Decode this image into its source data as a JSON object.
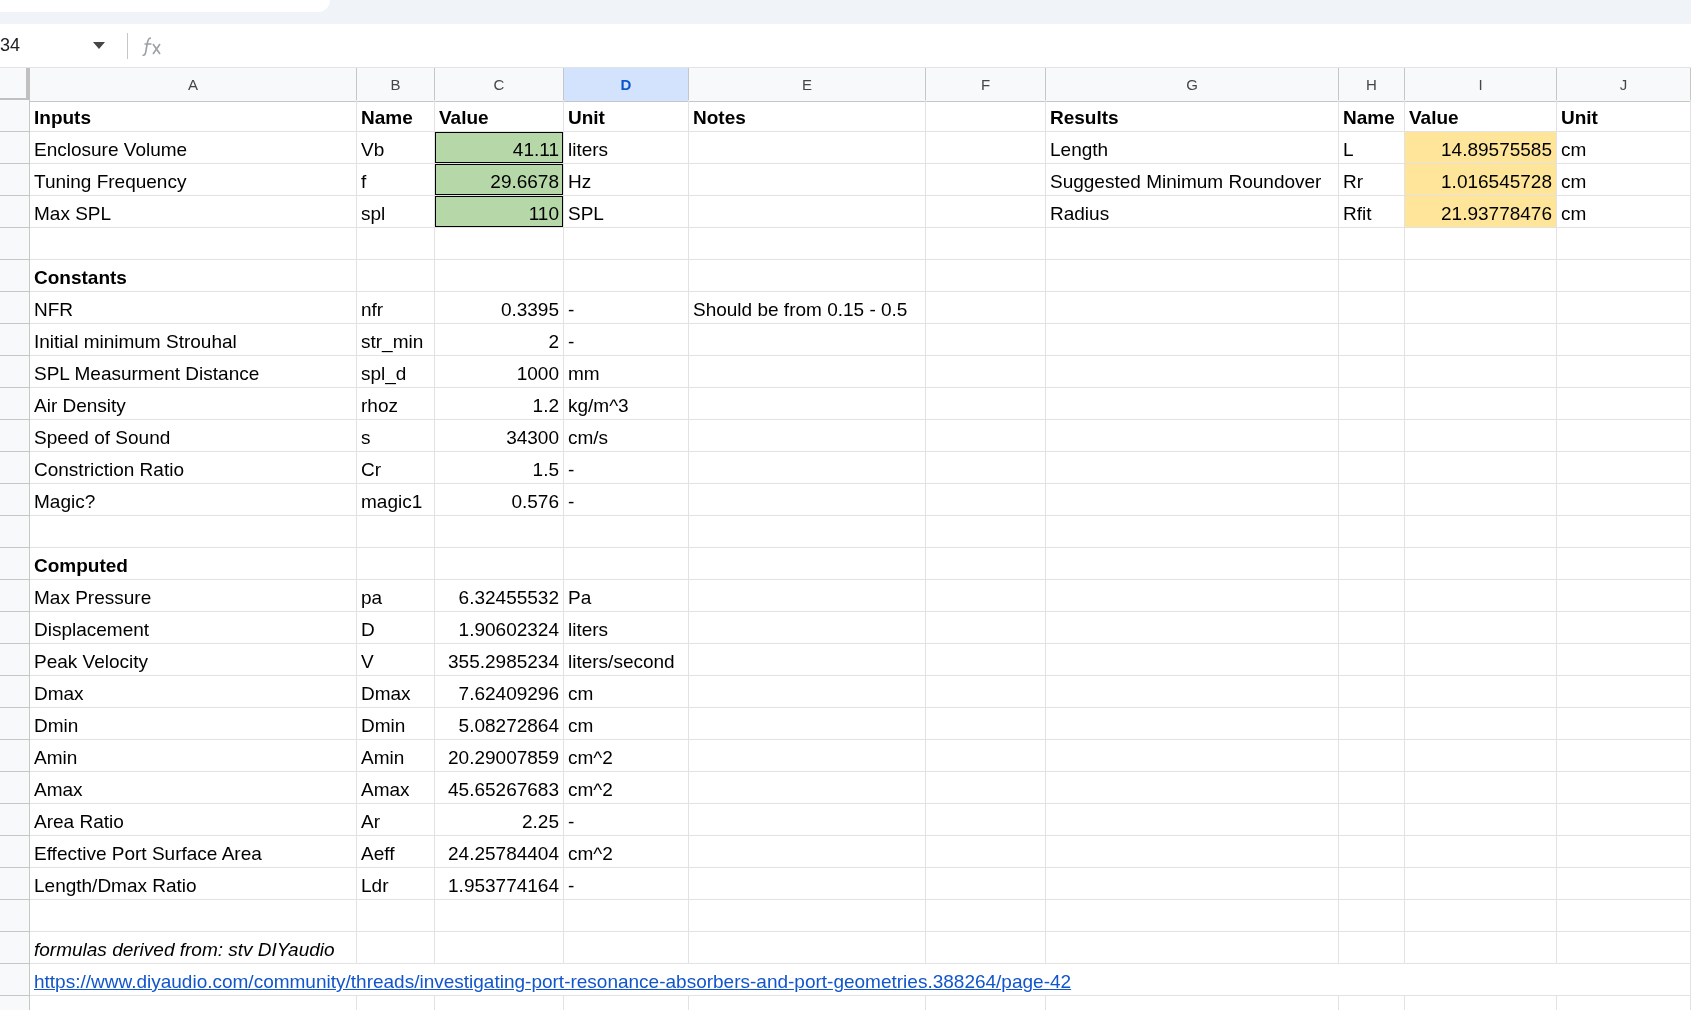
{
  "name_box": "34",
  "columns": [
    {
      "label": "A",
      "selected": false
    },
    {
      "label": "B",
      "selected": false
    },
    {
      "label": "C",
      "selected": false
    },
    {
      "label": "D",
      "selected": true
    },
    {
      "label": "E",
      "selected": false
    },
    {
      "label": "F",
      "selected": false
    },
    {
      "label": "G",
      "selected": false
    },
    {
      "label": "H",
      "selected": false
    },
    {
      "label": "I",
      "selected": false
    },
    {
      "label": "J",
      "selected": false
    }
  ],
  "rows": [
    {
      "A": {
        "kind": "header",
        "text": "Inputs"
      },
      "B": {
        "kind": "header",
        "text": "Name"
      },
      "C": {
        "kind": "header",
        "text": "Value"
      },
      "D": {
        "kind": "header",
        "text": "Unit"
      },
      "E": {
        "kind": "header",
        "text": "Notes"
      },
      "G": {
        "kind": "header",
        "text": "Results"
      },
      "H": {
        "kind": "header",
        "text": "Name"
      },
      "I": {
        "kind": "header",
        "text": "Value"
      },
      "J": {
        "kind": "header",
        "text": "Unit"
      }
    },
    {
      "A": {
        "kind": "text",
        "text": "Enclosure Volume"
      },
      "B": {
        "kind": "text",
        "text": "Vb"
      },
      "C": {
        "kind": "input",
        "text": "41.11"
      },
      "D": {
        "kind": "text",
        "text": "liters"
      },
      "G": {
        "kind": "text",
        "text": "Length"
      },
      "H": {
        "kind": "text",
        "text": "L"
      },
      "I": {
        "kind": "result",
        "text": "14.89575585"
      },
      "J": {
        "kind": "text",
        "text": "cm"
      }
    },
    {
      "A": {
        "kind": "text",
        "text": "Tuning Frequency"
      },
      "B": {
        "kind": "text",
        "text": "f"
      },
      "C": {
        "kind": "input",
        "text": "29.6678"
      },
      "D": {
        "kind": "text",
        "text": "Hz"
      },
      "G": {
        "kind": "text",
        "text": "Suggested Minimum Roundover"
      },
      "H": {
        "kind": "text",
        "text": "Rr"
      },
      "I": {
        "kind": "result",
        "text": "1.016545728"
      },
      "J": {
        "kind": "text",
        "text": "cm"
      }
    },
    {
      "A": {
        "kind": "text",
        "text": "Max SPL"
      },
      "B": {
        "kind": "text",
        "text": "spl"
      },
      "C": {
        "kind": "input",
        "text": "110"
      },
      "D": {
        "kind": "text",
        "text": "SPL"
      },
      "G": {
        "kind": "text",
        "text": "Radius"
      },
      "H": {
        "kind": "text",
        "text": "Rfit"
      },
      "I": {
        "kind": "result",
        "text": "21.93778476"
      },
      "J": {
        "kind": "text",
        "text": "cm"
      }
    },
    {},
    {
      "A": {
        "kind": "header",
        "text": "Constants"
      }
    },
    {
      "A": {
        "kind": "text",
        "text": "NFR"
      },
      "B": {
        "kind": "text",
        "text": "nfr"
      },
      "C": {
        "kind": "number",
        "text": "0.3395"
      },
      "D": {
        "kind": "text",
        "text": "-"
      },
      "E": {
        "kind": "text",
        "text": "Should be from 0.15 - 0.5"
      }
    },
    {
      "A": {
        "kind": "text",
        "text": "Initial minimum Strouhal"
      },
      "B": {
        "kind": "text",
        "text": "str_min"
      },
      "C": {
        "kind": "number",
        "text": "2"
      },
      "D": {
        "kind": "text",
        "text": "-"
      }
    },
    {
      "A": {
        "kind": "text",
        "text": "SPL Measurment Distance"
      },
      "B": {
        "kind": "text",
        "text": "spl_d"
      },
      "C": {
        "kind": "number",
        "text": "1000"
      },
      "D": {
        "kind": "text",
        "text": "mm"
      }
    },
    {
      "A": {
        "kind": "text",
        "text": "Air Density"
      },
      "B": {
        "kind": "text",
        "text": "rhoz"
      },
      "C": {
        "kind": "number",
        "text": "1.2"
      },
      "D": {
        "kind": "text",
        "text": "kg/m^3"
      }
    },
    {
      "A": {
        "kind": "text",
        "text": "Speed of Sound"
      },
      "B": {
        "kind": "text",
        "text": "s"
      },
      "C": {
        "kind": "number",
        "text": "34300"
      },
      "D": {
        "kind": "text",
        "text": "cm/s"
      }
    },
    {
      "A": {
        "kind": "text",
        "text": "Constriction Ratio"
      },
      "B": {
        "kind": "text",
        "text": "Cr"
      },
      "C": {
        "kind": "number",
        "text": "1.5"
      },
      "D": {
        "kind": "text",
        "text": "-"
      }
    },
    {
      "A": {
        "kind": "text",
        "text": "Magic?"
      },
      "B": {
        "kind": "text",
        "text": "magic1"
      },
      "C": {
        "kind": "number",
        "text": "0.576"
      },
      "D": {
        "kind": "text",
        "text": "-"
      }
    },
    {},
    {
      "A": {
        "kind": "header",
        "text": "Computed"
      }
    },
    {
      "A": {
        "kind": "text",
        "text": "Max Pressure"
      },
      "B": {
        "kind": "text",
        "text": "pa"
      },
      "C": {
        "kind": "number",
        "text": "6.32455532"
      },
      "D": {
        "kind": "text",
        "text": "Pa"
      }
    },
    {
      "A": {
        "kind": "text",
        "text": "Displacement"
      },
      "B": {
        "kind": "text",
        "text": "D"
      },
      "C": {
        "kind": "number",
        "text": "1.90602324"
      },
      "D": {
        "kind": "text",
        "text": "liters"
      }
    },
    {
      "A": {
        "kind": "text",
        "text": "Peak Velocity"
      },
      "B": {
        "kind": "text",
        "text": "V"
      },
      "C": {
        "kind": "number",
        "text": "355.2985234"
      },
      "D": {
        "kind": "text",
        "text": "liters/second"
      }
    },
    {
      "A": {
        "kind": "text",
        "text": "Dmax"
      },
      "B": {
        "kind": "text",
        "text": "Dmax"
      },
      "C": {
        "kind": "number",
        "text": "7.62409296"
      },
      "D": {
        "kind": "text",
        "text": "cm"
      }
    },
    {
      "A": {
        "kind": "text",
        "text": "Dmin"
      },
      "B": {
        "kind": "text",
        "text": "Dmin"
      },
      "C": {
        "kind": "number",
        "text": "5.08272864"
      },
      "D": {
        "kind": "text",
        "text": "cm"
      }
    },
    {
      "A": {
        "kind": "text",
        "text": "Amin"
      },
      "B": {
        "kind": "text",
        "text": "Amin"
      },
      "C": {
        "kind": "number",
        "text": "20.29007859"
      },
      "D": {
        "kind": "text",
        "text": "cm^2"
      }
    },
    {
      "A": {
        "kind": "text",
        "text": "Amax"
      },
      "B": {
        "kind": "text",
        "text": "Amax"
      },
      "C": {
        "kind": "number",
        "text": "45.65267683"
      },
      "D": {
        "kind": "text",
        "text": "cm^2"
      }
    },
    {
      "A": {
        "kind": "text",
        "text": "Area Ratio"
      },
      "B": {
        "kind": "text",
        "text": "Ar"
      },
      "C": {
        "kind": "number",
        "text": "2.25"
      },
      "D": {
        "kind": "text",
        "text": "-"
      }
    },
    {
      "A": {
        "kind": "text",
        "text": "Effective Port Surface Area"
      },
      "B": {
        "kind": "text",
        "text": "Aeff"
      },
      "C": {
        "kind": "number",
        "text": "24.25784404"
      },
      "D": {
        "kind": "text",
        "text": "cm^2"
      }
    },
    {
      "A": {
        "kind": "text",
        "text": "Length/Dmax Ratio"
      },
      "B": {
        "kind": "text",
        "text": "Ldr"
      },
      "C": {
        "kind": "number",
        "text": "1.953774164"
      },
      "D": {
        "kind": "text",
        "text": "-"
      }
    },
    {},
    {
      "A": {
        "kind": "note",
        "text": "formulas derived from: stv DIYaudio"
      }
    },
    {
      "A": {
        "kind": "link",
        "text": "https://www.diyaudio.com/community/threads/investigating-port-resonance-absorbers-and-port-geometries.388264/page-42"
      }
    },
    {}
  ]
}
